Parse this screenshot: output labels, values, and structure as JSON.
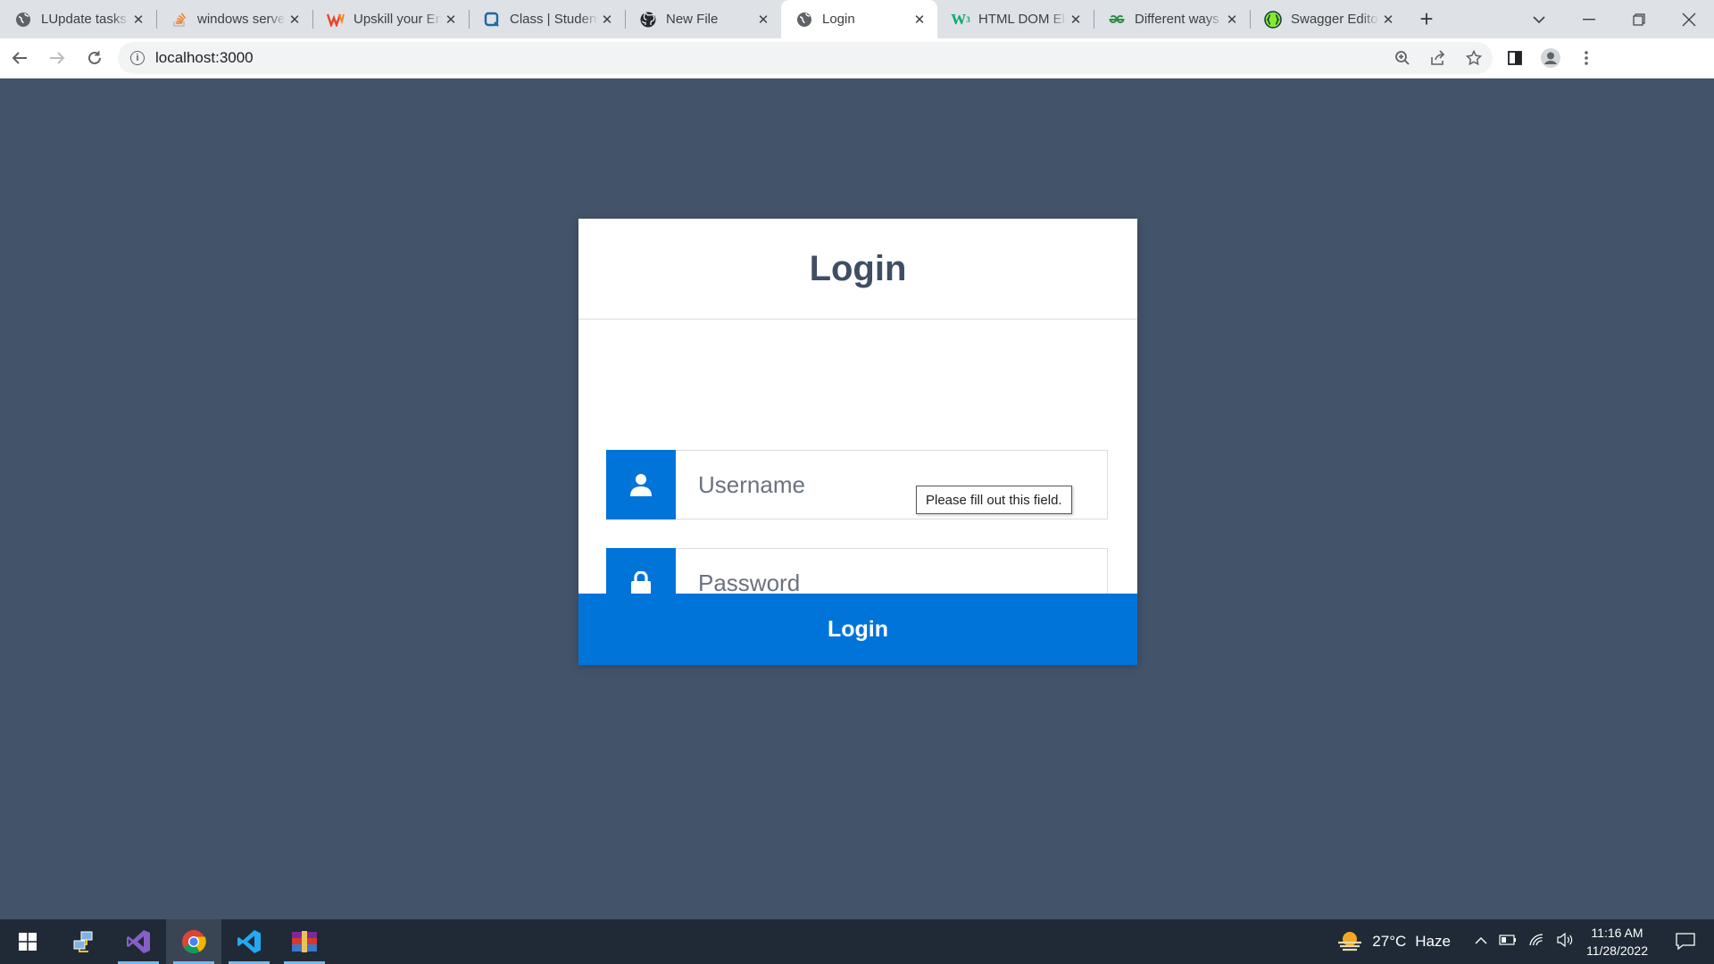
{
  "browser": {
    "tabs": [
      {
        "title": "LUpdate tasks",
        "icon": "globe-icon",
        "active": false
      },
      {
        "title": "windows server",
        "icon": "stackoverflow-icon",
        "active": false
      },
      {
        "title": "Upskill your Engineers",
        "icon": "w-logo-icon",
        "active": false
      },
      {
        "title": "Class | Student",
        "icon": "q-logo-icon",
        "active": false
      },
      {
        "title": "New File",
        "icon": "github-icon",
        "active": false
      },
      {
        "title": "Login",
        "icon": "globe-icon",
        "active": true
      },
      {
        "title": "HTML DOM Element",
        "icon": "w3schools-icon",
        "active": false
      },
      {
        "title": "Different ways",
        "icon": "geeksforgeeks-icon",
        "active": false
      },
      {
        "title": "Swagger Editor",
        "icon": "swagger-icon",
        "active": false
      }
    ],
    "url": "localhost:3000"
  },
  "login": {
    "title": "Login",
    "username_placeholder": "Username",
    "password_placeholder": "Password",
    "validation_tooltip": "Please fill out this field.",
    "button_label": "Login",
    "accent_color": "#0074d9",
    "background_color": "#435369"
  },
  "taskbar": {
    "apps": [
      "windows-start-icon",
      "network-app-icon",
      "visual-studio-icon",
      "chrome-icon",
      "vscode-icon",
      "winrar-icon"
    ],
    "weather": {
      "temp": "27°C",
      "condition": "Haze"
    },
    "time": "11:16 AM",
    "date": "11/28/2022"
  }
}
